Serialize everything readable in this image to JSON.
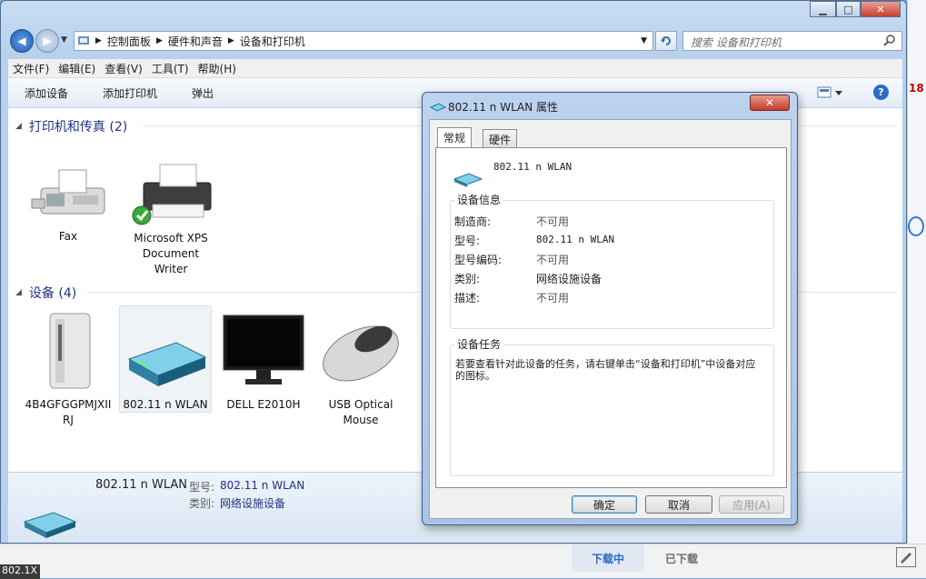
{
  "explorer": {
    "breadcrumb": [
      "控制面板",
      "硬件和声音",
      "设备和打印机"
    ],
    "search_placeholder": "搜索 设备和打印机",
    "menu": [
      "文件(F)",
      "编辑(E)",
      "查看(V)",
      "工具(T)",
      "帮助(H)"
    ],
    "commands": [
      "添加设备",
      "添加打印机",
      "弹出"
    ],
    "groups": {
      "printers": {
        "title": "打印机和传真 (2)",
        "items": [
          {
            "label": "Fax"
          },
          {
            "label": "Microsoft XPS Document Writer"
          }
        ]
      },
      "devices": {
        "title": "设备 (4)",
        "items": [
          {
            "label": "4B4GFGGPMJXIIRJ"
          },
          {
            "label": "802.11 n WLAN"
          },
          {
            "label": "DELL E2010H"
          },
          {
            "label": "USB Optical Mouse"
          }
        ]
      }
    },
    "details": {
      "name": "802.11 n WLAN",
      "model_label": "型号:",
      "model_value": "802.11 n WLAN",
      "category_label": "类别:",
      "category_value": "网络设施设备"
    }
  },
  "dialog": {
    "title": "802.11 n WLAN 属性",
    "tabs": [
      "常规",
      "硬件"
    ],
    "device_name": "802.11 n WLAN",
    "info_group": "设备信息",
    "info": [
      {
        "key": "制造商:",
        "value": "不可用"
      },
      {
        "key": "型号:",
        "value": "802.11 n WLAN"
      },
      {
        "key": "型号编码:",
        "value": "不可用"
      },
      {
        "key": "类别:",
        "value": "网络设施设备"
      },
      {
        "key": "描述:",
        "value": "不可用"
      }
    ],
    "tasks_group": "设备任务",
    "tasks_text": "若要查看针对此设备的任务，请右键单击“设备和打印机”中设备对应的图标。",
    "buttons": {
      "ok": "确定",
      "cancel": "取消",
      "apply": "应用(A)"
    }
  },
  "background": {
    "tab_downloading": "下载中",
    "tab_downloaded": "已下载",
    "taskbar_label": "802.1X",
    "number": "18"
  }
}
